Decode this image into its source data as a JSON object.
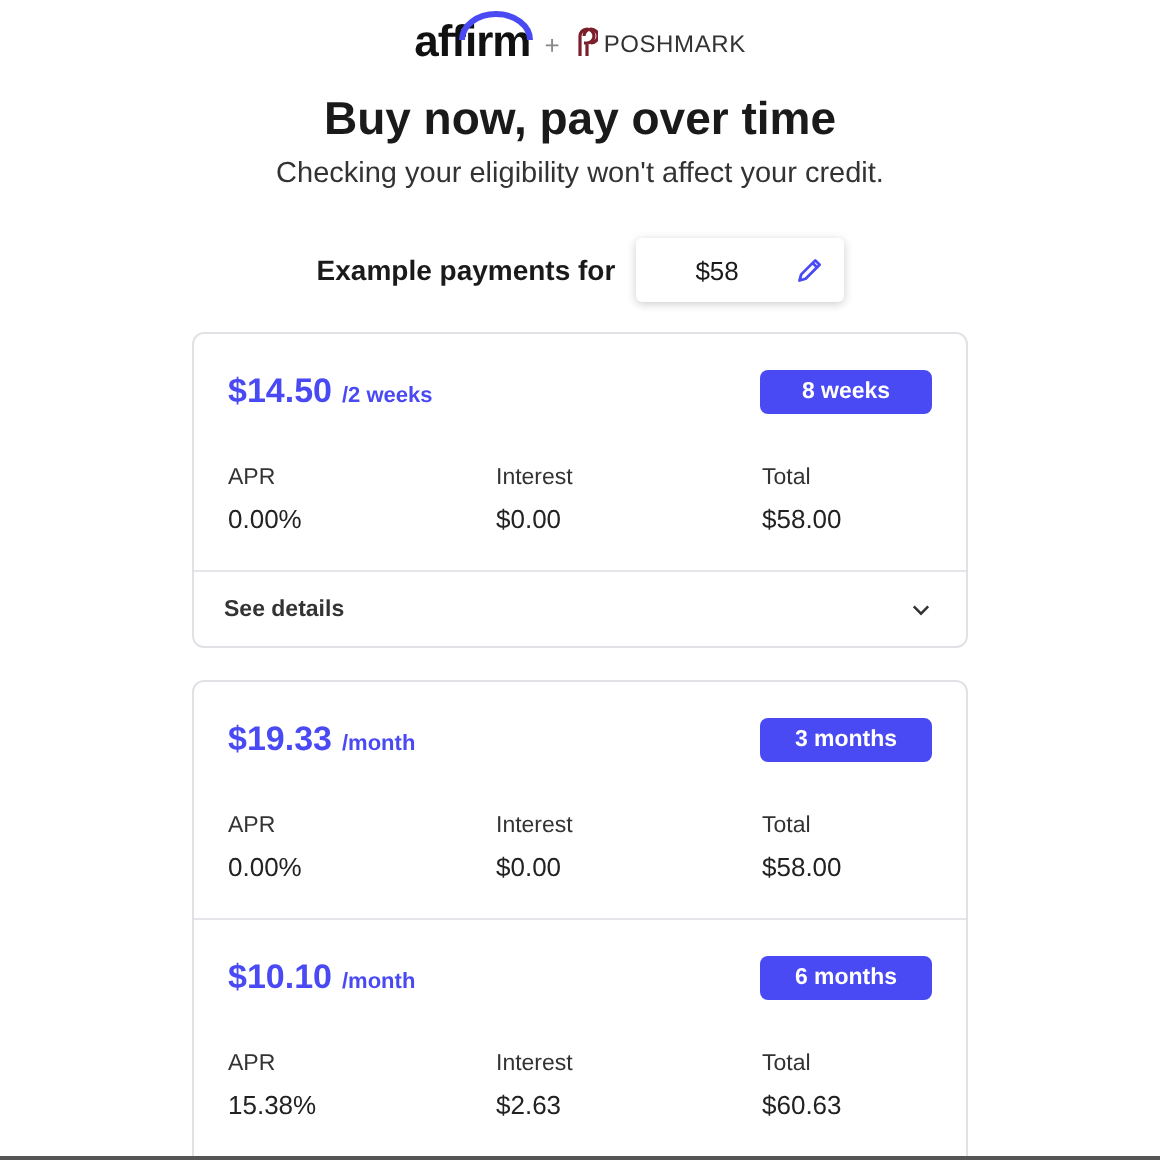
{
  "header": {
    "brand": "affirm",
    "separator": "+",
    "partner": "POSHMARK"
  },
  "title": "Buy now, pay over time",
  "subtitle": "Checking your eligibility won't affect your credit.",
  "amount": {
    "label": "Example payments for",
    "value": "$58"
  },
  "cards": [
    {
      "plans": [
        {
          "amount": "$14.50",
          "period": "/2 weeks",
          "term": "8 weeks",
          "stats": [
            {
              "label": "APR",
              "value": "0.00%"
            },
            {
              "label": "Interest",
              "value": "$0.00"
            },
            {
              "label": "Total",
              "value": "$58.00"
            }
          ]
        }
      ],
      "details": {
        "label": "See details",
        "expanded": false
      }
    },
    {
      "plans": [
        {
          "amount": "$19.33",
          "period": "/month",
          "term": "3 months",
          "stats": [
            {
              "label": "APR",
              "value": "0.00%"
            },
            {
              "label": "Interest",
              "value": "$0.00"
            },
            {
              "label": "Total",
              "value": "$58.00"
            }
          ]
        },
        {
          "amount": "$10.10",
          "period": "/month",
          "term": "6 months",
          "stats": [
            {
              "label": "APR",
              "value": "15.38%"
            },
            {
              "label": "Interest",
              "value": "$2.63"
            },
            {
              "label": "Total",
              "value": "$60.63"
            }
          ]
        }
      ]
    }
  ]
}
